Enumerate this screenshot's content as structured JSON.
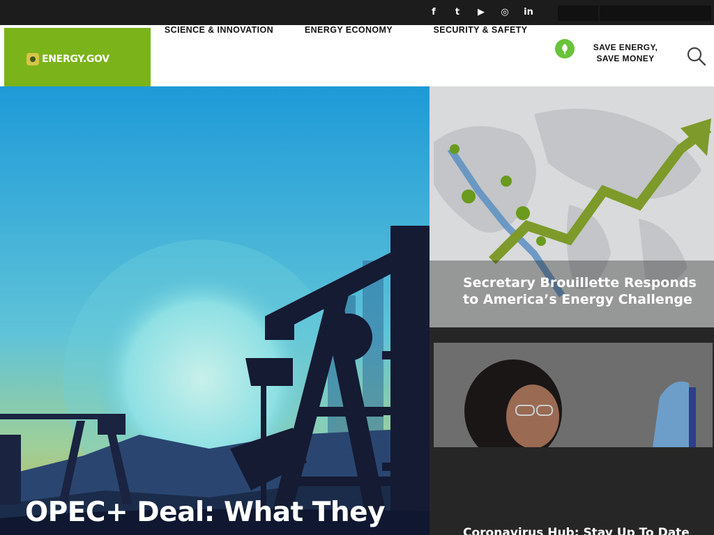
{
  "social": {
    "facebook": "f",
    "twitter": "t",
    "youtube": "▶",
    "instagram": "◎",
    "linkedin": "in"
  },
  "logo": {
    "text": "ENERGY.GOV"
  },
  "nav": {
    "science": "SCIENCE & INNOVATION",
    "economy": "ENERGY ECONOMY",
    "security": "SECURITY & SAFETY",
    "save_line1": "SAVE ENERGY,",
    "save_line2": "SAVE MONEY"
  },
  "hero": {
    "title": "OPEC+ Deal: What They"
  },
  "cards": {
    "map_title": "Secretary Brouillette Responds to America’s Energy Challenge",
    "sci_title": "Coronavirus Hub: Stay Up To Date"
  },
  "colors": {
    "brand_green": "#7bb31a",
    "sky_top": "#1e9ad8",
    "topbar": "#1c1c1c"
  },
  "icons": {
    "search": "search-icon",
    "leaf": "leaf-icon"
  }
}
